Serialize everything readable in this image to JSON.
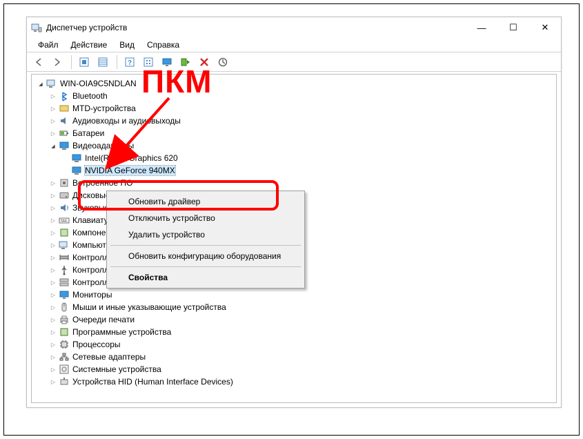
{
  "window": {
    "title": "Диспетчер устройств",
    "controls": {
      "min": "—",
      "max": "☐",
      "close": "✕"
    }
  },
  "menubar": [
    "Файл",
    "Действие",
    "Вид",
    "Справка"
  ],
  "toolbar_icons": [
    "nav-back-icon",
    "nav-forward-icon",
    "show-hidden-icon",
    "properties-icon",
    "help-icon",
    "scan-icon",
    "monitor-icon",
    "enable-icon",
    "disable-icon",
    "refresh-icon"
  ],
  "annotation": {
    "text": "ПКМ"
  },
  "tree": {
    "root": {
      "label": "WIN-OIA9C5NDLAN",
      "expanded": true,
      "icon": "computer-icon"
    },
    "children": [
      {
        "label": "Bluetooth",
        "expanded": false,
        "icon": "bluetooth-icon"
      },
      {
        "label": "MTD-устройства",
        "expanded": false,
        "icon": "mtd-icon"
      },
      {
        "label": "Аудиовходы и аудиовыходы",
        "expanded": false,
        "icon": "audio-icon"
      },
      {
        "label": "Батареи",
        "expanded": false,
        "icon": "battery-icon"
      },
      {
        "label": "Видеоадаптеры",
        "expanded": true,
        "icon": "display-adapter-icon",
        "children": [
          {
            "label": "Intel(R) HD Graphics 620",
            "icon": "display-adapter-icon",
            "leaf": true
          },
          {
            "label": "NVIDIA GeForce 940MX",
            "icon": "display-adapter-icon",
            "leaf": true,
            "selected": true
          }
        ]
      },
      {
        "label": "Встроенное ПО",
        "expanded": false,
        "icon": "firmware-icon"
      },
      {
        "label": "Дисковые устройства",
        "expanded": false,
        "icon": "disk-icon"
      },
      {
        "label": "Звуковые, игровые и видеоустройства",
        "expanded": false,
        "icon": "sound-icon"
      },
      {
        "label": "Клавиатуры",
        "expanded": false,
        "icon": "keyboard-icon"
      },
      {
        "label": "Компоненты программного обеспечения",
        "expanded": false,
        "icon": "software-icon"
      },
      {
        "label": "Компьютер",
        "expanded": false,
        "icon": "computer-icon"
      },
      {
        "label": "Контроллеры IDE ATA/ATAPI",
        "expanded": false,
        "icon": "ide-icon"
      },
      {
        "label": "Контроллеры USB",
        "expanded": false,
        "icon": "usb-icon"
      },
      {
        "label": "Контроллеры запоминающих устройств",
        "expanded": false,
        "icon": "storage-icon"
      },
      {
        "label": "Мониторы",
        "expanded": false,
        "icon": "monitor-icon"
      },
      {
        "label": "Мыши и иные указывающие устройства",
        "expanded": false,
        "icon": "mouse-icon"
      },
      {
        "label": "Очереди печати",
        "expanded": false,
        "icon": "printer-icon"
      },
      {
        "label": "Программные устройства",
        "expanded": false,
        "icon": "software-icon"
      },
      {
        "label": "Процессоры",
        "expanded": false,
        "icon": "cpu-icon"
      },
      {
        "label": "Сетевые адаптеры",
        "expanded": false,
        "icon": "network-icon"
      },
      {
        "label": "Системные устройства",
        "expanded": false,
        "icon": "system-icon"
      },
      {
        "label": "Устройства HID (Human Interface Devices)",
        "expanded": false,
        "icon": "hid-icon"
      }
    ]
  },
  "context_menu": {
    "items": [
      {
        "label": "Обновить драйвер",
        "sep_after": false
      },
      {
        "label": "Отключить устройство",
        "sep_after": false,
        "highlight": true
      },
      {
        "label": "Удалить устройство",
        "sep_after": true
      },
      {
        "label": "Обновить конфигурацию оборудования",
        "sep_after": true
      },
      {
        "label": "Свойства",
        "bold": true
      }
    ]
  }
}
